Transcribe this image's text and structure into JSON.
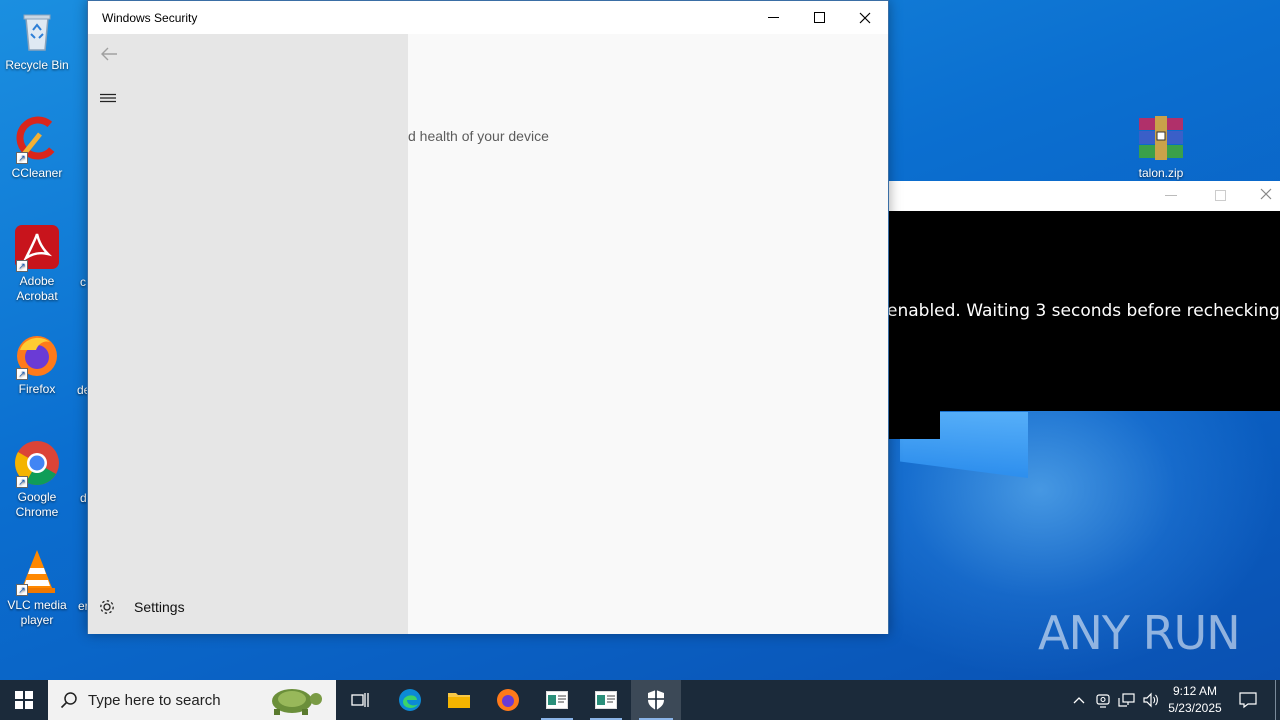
{
  "desktop": {
    "icons": [
      {
        "label": "Recycle Bin",
        "icon": "recycle-bin-icon"
      },
      {
        "label": "CCleaner",
        "icon": "ccleaner-icon"
      },
      {
        "label": "Adobe Acrobat",
        "icon": "adobe-acrobat-icon"
      },
      {
        "label": "Firefox",
        "icon": "firefox-icon"
      },
      {
        "label": "Google Chrome",
        "icon": "chrome-icon"
      },
      {
        "label": "VLC media player",
        "icon": "vlc-icon"
      }
    ],
    "partial_labels": [
      "c",
      "de",
      "d",
      "er"
    ],
    "zip_file": {
      "label": "talon.zip",
      "icon": "winrar-archive-icon"
    }
  },
  "windows_security": {
    "title": "Windows Security",
    "back_icon": "back-arrow-icon",
    "menu_icon": "hamburger-menu-icon",
    "subtitle_fragment": "d health of your device",
    "settings_label": "Settings",
    "settings_icon": "gear-icon"
  },
  "console": {
    "output_line": "enabled. Waiting 3 seconds before rechecking..."
  },
  "watermark": "ANY RUN",
  "taskbar": {
    "search_placeholder": "Type here to search",
    "clock_time": "9:12 AM",
    "clock_date": "5/23/2025"
  }
}
